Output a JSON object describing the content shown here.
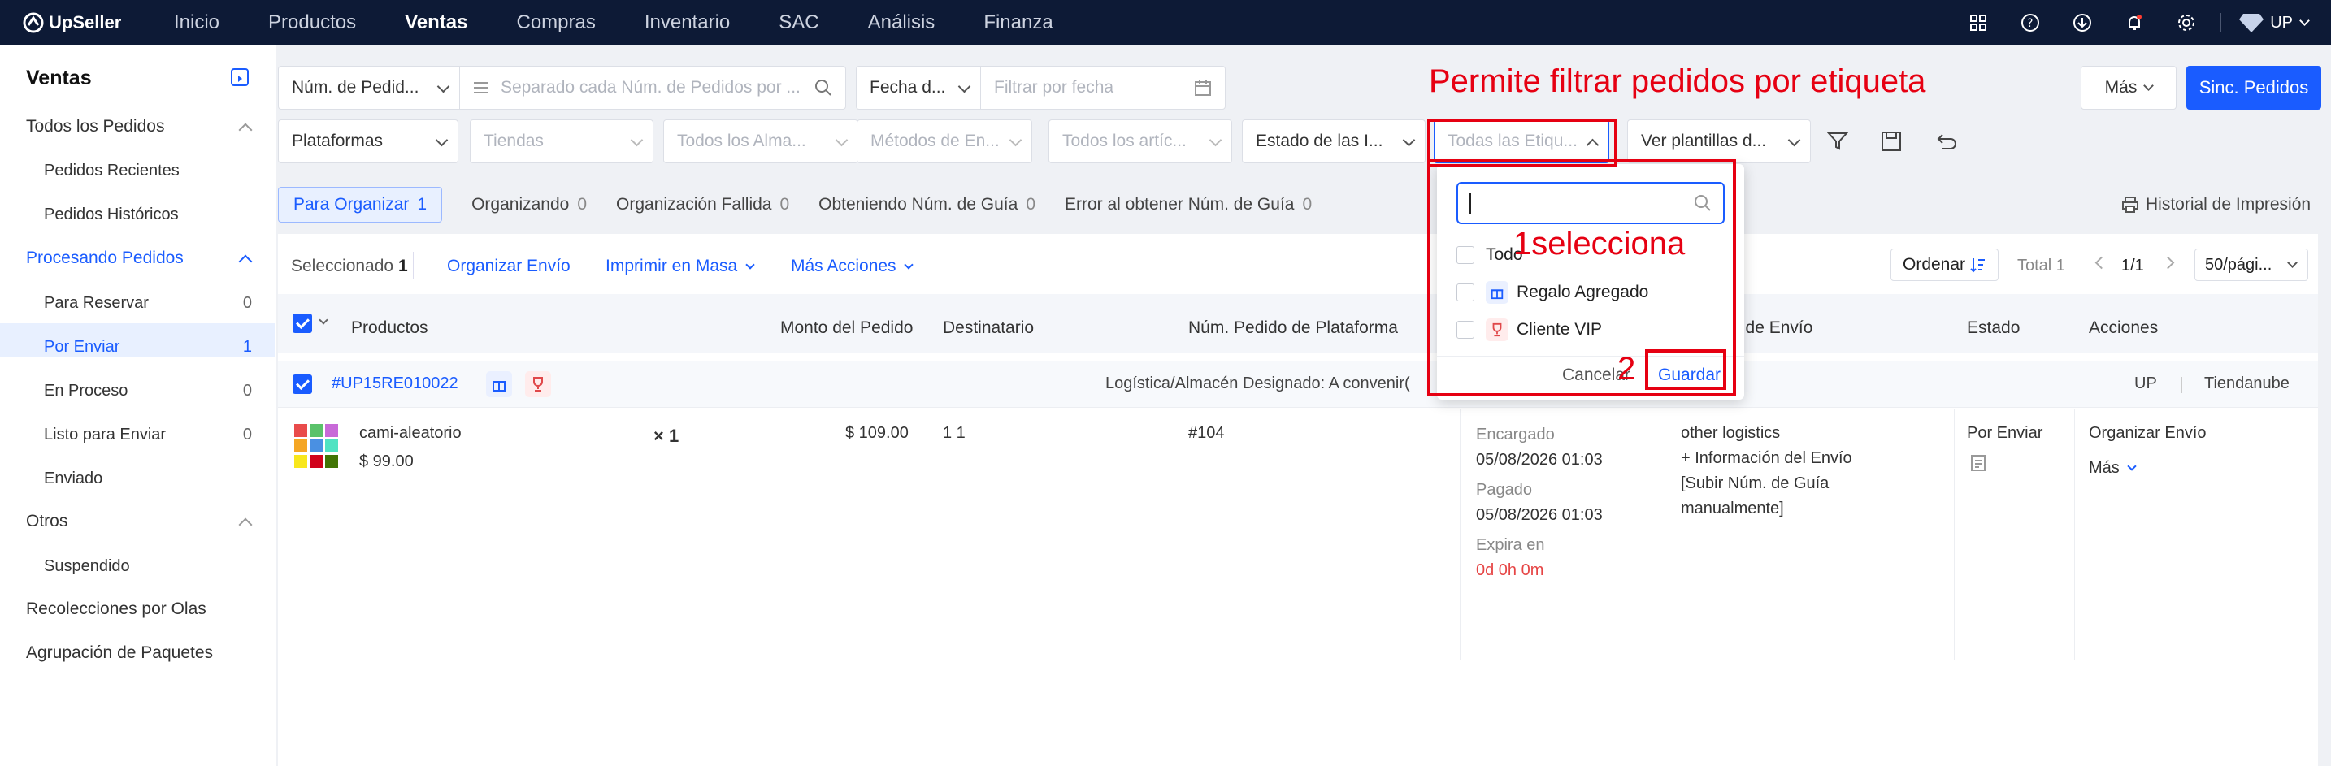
{
  "topbar": {
    "brand": "UpSeller",
    "nav": [
      "Inicio",
      "Productos",
      "Ventas",
      "Compras",
      "Inventario",
      "SAC",
      "Análisis",
      "Finanza"
    ],
    "active": "Ventas",
    "user": "UP"
  },
  "sidebar": {
    "title": "Ventas",
    "all_orders": "Todos los Pedidos",
    "recent": "Pedidos Recientes",
    "historic": "Pedidos Históricos",
    "processing": "Procesando Pedidos",
    "reserve": "Para Reservar",
    "reserve_n": "0",
    "to_send": "Por Enviar",
    "to_send_n": "1",
    "in_process": "En Proceso",
    "in_process_n": "0",
    "ready": "Listo para Enviar",
    "ready_n": "0",
    "sent": "Enviado",
    "others": "Otros",
    "suspended": "Suspendido",
    "waves": "Recolecciones por Olas",
    "packages": "Agrupación de Paquetes"
  },
  "filters": {
    "order_num": "Núm. de Pedid...",
    "order_ph": "Separado cada Núm. de Pedidos por ...",
    "date": "Fecha d...",
    "date_ph": "Filtrar por fecha",
    "more": "Más",
    "sync": "Sinc. Pedidos",
    "platforms": "Plataformas",
    "stores": "Tiendas",
    "warehouses": "Todos los Alma...",
    "methods": "Métodos de En...",
    "items": "Todos los artíc...",
    "state": "Estado de las I...",
    "tags": "Todas las Etiqu...",
    "templates": "Ver plantillas d..."
  },
  "tabs": [
    {
      "label": "Para Organizar",
      "n": "1"
    },
    {
      "label": "Organizando",
      "n": "0"
    },
    {
      "label": "Organización Fallida",
      "n": "0"
    },
    {
      "label": "Obteniendo Núm. de Guía",
      "n": "0"
    },
    {
      "label": "Error al obtener Núm. de Guía",
      "n": "0"
    }
  ],
  "print_history": "Historial de Impresión",
  "toolbar": {
    "selected": "Seleccionado",
    "selected_n": "1",
    "organize": "Organizar Envío",
    "print": "Imprimir en Masa",
    "more": "Más Acciones",
    "order": "Ordenar",
    "total": "Total 1",
    "page": "1/1",
    "per_page": "50/pági..."
  },
  "table": {
    "headers": {
      "products": "Productos",
      "amount": "Monto del Pedido",
      "recipient": "Destinatario",
      "platform_num": "Núm. Pedido de Plataforma",
      "shipping": "...es de Envío",
      "state": "Estado",
      "actions": "Acciones"
    }
  },
  "order": {
    "id": "#UP15RE010022",
    "logistics_label": "Logística/Almacén Designado:",
    "logistics_value": "A convenir(",
    "platform": "UP",
    "store": "Tiendanube",
    "product": "cami-aleatorio",
    "price": "$ 99.00",
    "qty": "× 1",
    "amount": "$ 109.00",
    "recipient": "1 1",
    "platform_num": "#104",
    "ordered_label": "Encargado",
    "ordered": "05/08/2026 01:03",
    "paid_label": "Pagado",
    "paid": "05/08/2026 01:03",
    "expires_label": "Expira en",
    "expires": "0d 0h 0m",
    "logistics": "other logistics",
    "ship_info": "+ Información del Envío",
    "upload": "[Subir Núm. de Guía manualmente]",
    "status": "Por Enviar",
    "action": "Organizar Envío",
    "action_more": "Más"
  },
  "dropdown": {
    "all": "Todo",
    "tag1": "Regalo Agregado",
    "tag2": "Cliente VIP",
    "cancel": "Cancelar",
    "save": "Guardar"
  },
  "annotations": {
    "title": "Permite filtrar pedidos por etiqueta",
    "step1": "1",
    "step1_text": "selecciona",
    "step2": "2"
  },
  "colors": {
    "brand": "#1a5cff",
    "topbar": "#0d1a36",
    "annotation": "#e60012"
  }
}
